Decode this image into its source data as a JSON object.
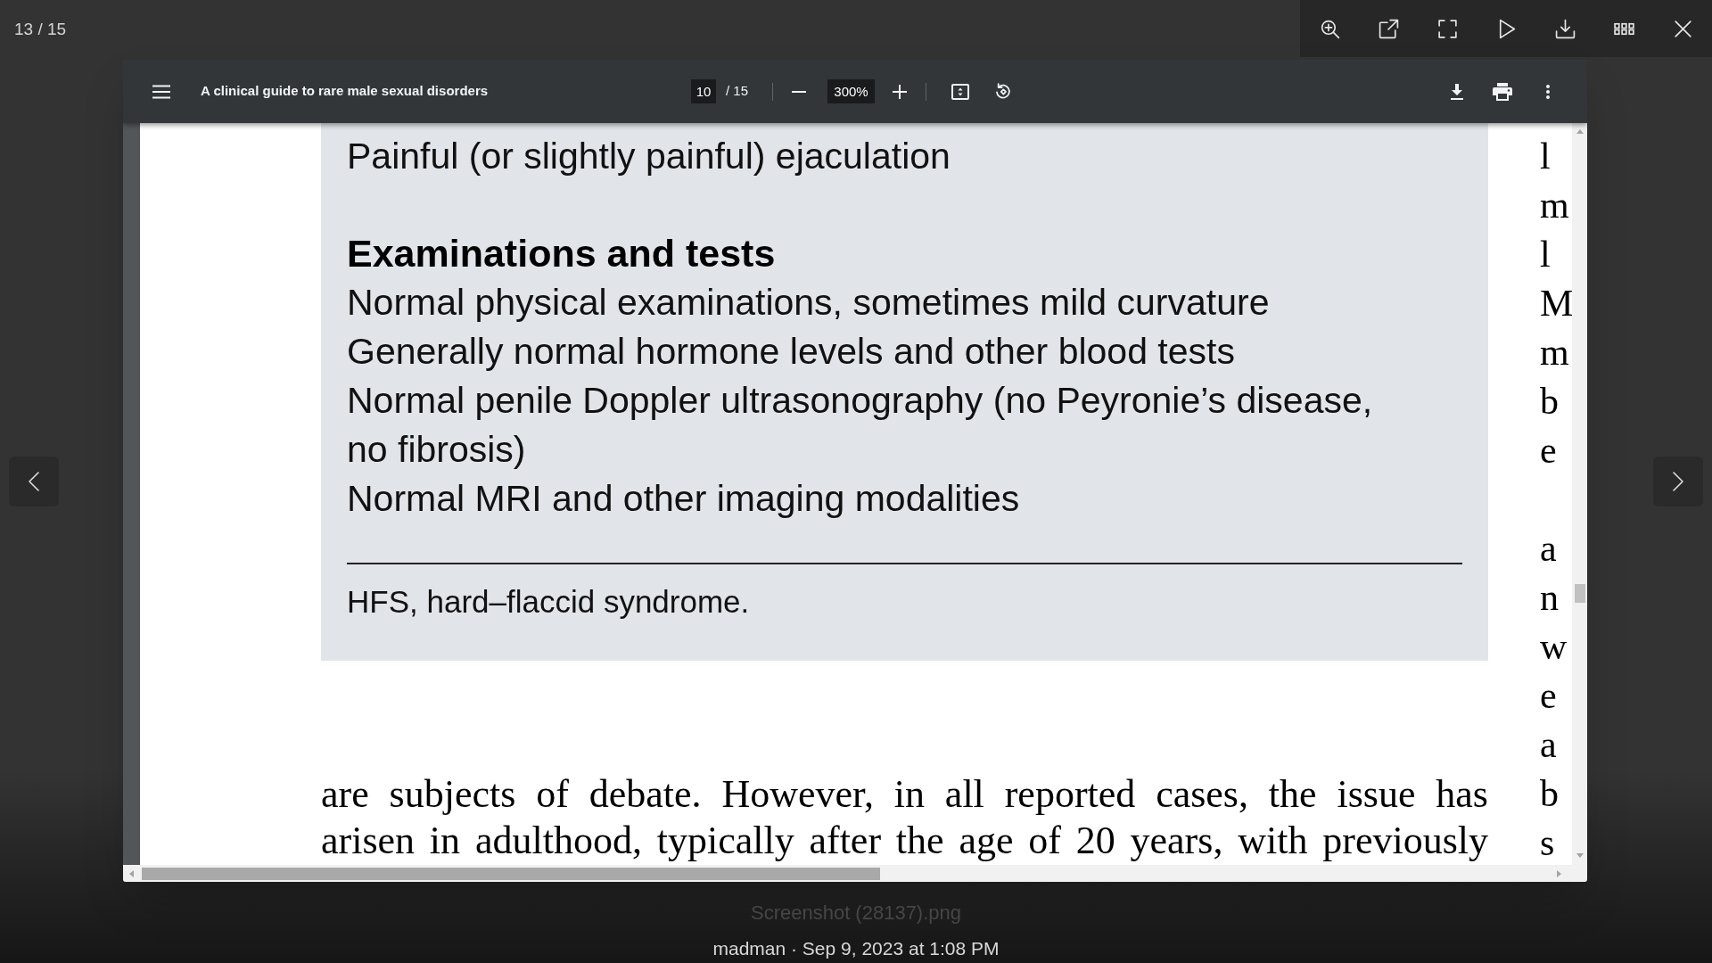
{
  "lightbox": {
    "counter": "13 / 15"
  },
  "pdf_viewer": {
    "title": "A clinical guide to rare male sexual disorders",
    "page_number": "10",
    "page_count": "/ 15",
    "zoom": "300%"
  },
  "page": {
    "box": {
      "items": [
        {
          "kind": "line",
          "text": "Painful (or slightly painful) ejaculation"
        },
        {
          "kind": "heading",
          "text": "Examinations and tests"
        },
        {
          "kind": "line",
          "text": "Normal physical examinations, sometimes mild curvature"
        },
        {
          "kind": "line",
          "text": "Generally normal hormone levels and other blood tests"
        },
        {
          "kind": "line",
          "text": "Normal penile Doppler ultrasonography (no Peyronie’s disease, no fibrosis)"
        },
        {
          "kind": "line",
          "text": "Normal MRI and other imaging modalities"
        }
      ],
      "footnote": "HFS, hard–flaccid syndrome."
    },
    "body_paragraph": {
      "lines": [
        "are subjects of debate. However, in all reported cases, the issue has",
        "arisen in adulthood, typically after the age of 20 years, with previously"
      ]
    },
    "column_2": [
      {
        "lines": [
          "l",
          "m",
          "l",
          "M",
          "m",
          "b",
          "e"
        ]
      },
      {
        "lines": [
          "a",
          "n",
          "w",
          "e",
          "a",
          "b",
          "s"
        ]
      }
    ]
  },
  "caption": {
    "filename": "Screenshot (28137).png",
    "byline": "madman · Sep 9, 2023 at 1:08 PM"
  }
}
